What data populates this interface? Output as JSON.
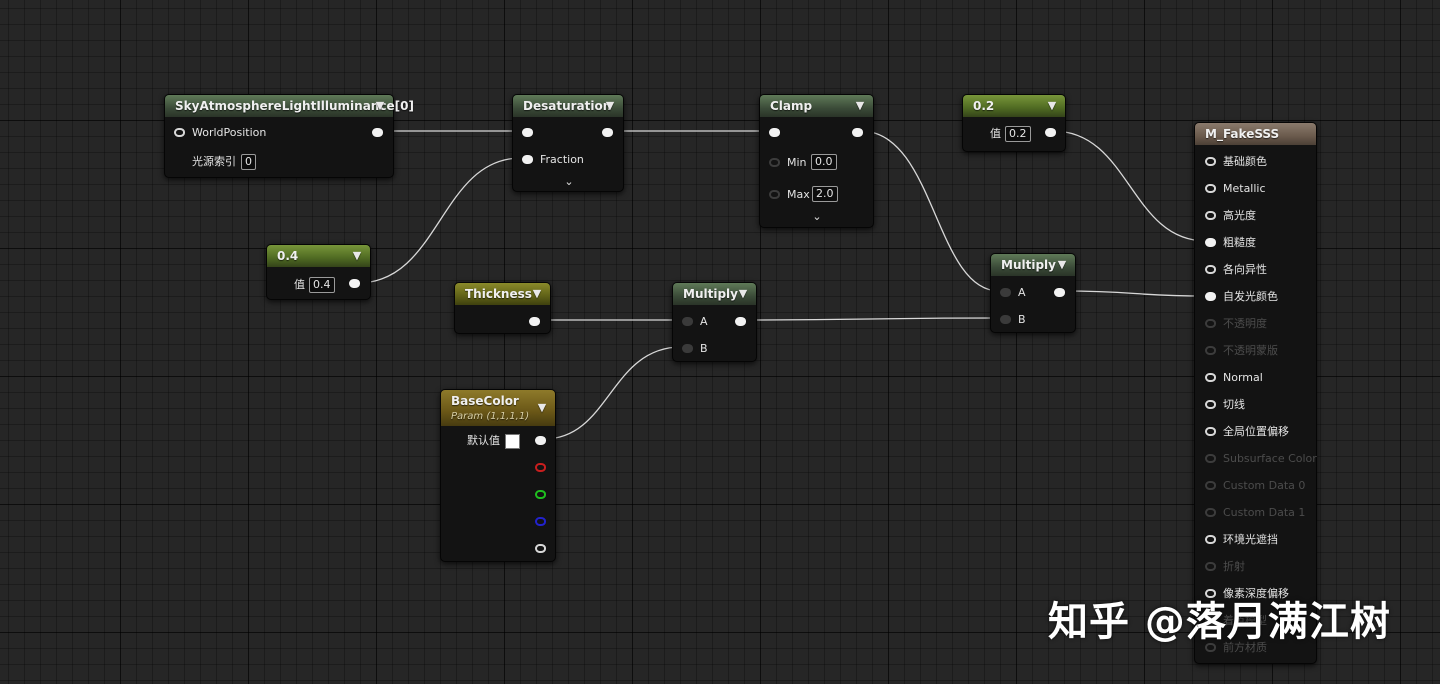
{
  "colors": {
    "background": "#262626",
    "wire": "#d8d8d8",
    "header_green": "#3b4b38",
    "header_lime": "#4f6a22",
    "header_olive": "#5f6117",
    "header_gold": "#6a5717",
    "header_tan": "#6a5a4c"
  },
  "nodes": {
    "sky": {
      "title": "SkyAtmosphereLightIlluminance[0]",
      "input_world_position": "WorldPosition",
      "input_light_index": "光源索引",
      "light_index_value": "0"
    },
    "desat": {
      "title": "Desaturation",
      "input_fraction": "Fraction"
    },
    "clamp": {
      "title": "Clamp",
      "min_label": "Min",
      "min_value": "0.0",
      "max_label": "Max",
      "max_value": "2.0"
    },
    "const_02": {
      "title": "0.2",
      "value_label": "值",
      "value": "0.2"
    },
    "const_04": {
      "title": "0.4",
      "value_label": "值",
      "value": "0.4"
    },
    "thickness": {
      "title": "Thickness"
    },
    "multiply1": {
      "title": "Multiply",
      "input_a": "A",
      "input_b": "B"
    },
    "multiply2": {
      "title": "Multiply",
      "input_a": "A",
      "input_b": "B"
    },
    "basecolor": {
      "title": "BaseColor",
      "subtitle": "Param (1,1,1,1)",
      "default_label": "默认值"
    },
    "material": {
      "title": "M_FakeSSS",
      "inputs": [
        {
          "label": "基础颜色",
          "enabled": true,
          "connected": false
        },
        {
          "label": "Metallic",
          "enabled": true,
          "connected": false
        },
        {
          "label": "高光度",
          "enabled": true,
          "connected": false
        },
        {
          "label": "粗糙度",
          "enabled": true,
          "connected": true
        },
        {
          "label": "各向异性",
          "enabled": true,
          "connected": false
        },
        {
          "label": "自发光颜色",
          "enabled": true,
          "connected": true
        },
        {
          "label": "不透明度",
          "enabled": false,
          "connected": false
        },
        {
          "label": "不透明蒙版",
          "enabled": false,
          "connected": false
        },
        {
          "label": "Normal",
          "enabled": true,
          "connected": false
        },
        {
          "label": "切线",
          "enabled": true,
          "connected": false
        },
        {
          "label": "全局位置偏移",
          "enabled": true,
          "connected": false
        },
        {
          "label": "Subsurface Color",
          "enabled": false,
          "connected": false
        },
        {
          "label": "Custom Data 0",
          "enabled": false,
          "connected": false
        },
        {
          "label": "Custom Data 1",
          "enabled": false,
          "connected": false
        },
        {
          "label": "环境光遮挡",
          "enabled": true,
          "connected": false
        },
        {
          "label": "折射",
          "enabled": false,
          "connected": false
        },
        {
          "label": "像素深度偏移",
          "enabled": true,
          "connected": false
        },
        {
          "label": "着色模型",
          "enabled": false,
          "connected": false
        },
        {
          "label": "前方材质",
          "enabled": false,
          "connected": false
        }
      ]
    }
  },
  "watermark": "知乎 @落月满江树"
}
